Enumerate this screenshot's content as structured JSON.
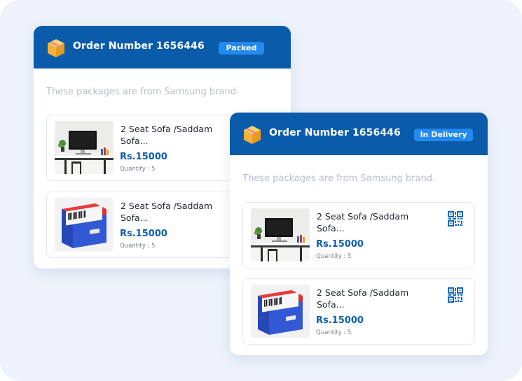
{
  "colors": {
    "header": "#0a5cab",
    "badge": "#2389ee",
    "price": "#0d5fae",
    "background": "#edf2fb"
  },
  "orders": [
    {
      "title": "Order Number 1656446",
      "status": "Packed",
      "subtitle": "These packages are from Samsung brand.",
      "icon": "package-box-icon",
      "items": [
        {
          "name": "2 Seat Sofa /Saddam Sofa...",
          "price": "Rs.15000",
          "quantity": "Quantity : 5",
          "image": "desk-computer-image"
        },
        {
          "name": "2 Seat Sofa /Saddam Sofa...",
          "price": "Rs.15000",
          "quantity": "Quantity : 5",
          "image": "blue-product-box-image"
        }
      ]
    },
    {
      "title": "Order Number 1656446",
      "status": "In Delivery",
      "subtitle": "These packages are from Samsung brand.",
      "icon": "package-box-icon",
      "items": [
        {
          "name": "2 Seat Sofa /Saddam Sofa...",
          "price": "Rs.15000",
          "quantity": "Quantity : 5",
          "image": "desk-computer-image",
          "action_icon": "qr-code-icon"
        },
        {
          "name": "2 Seat Sofa /Saddam Sofa...",
          "price": "Rs.15000",
          "quantity": "Quantity : 5",
          "image": "blue-product-box-image",
          "action_icon": "qr-code-icon"
        }
      ]
    }
  ]
}
